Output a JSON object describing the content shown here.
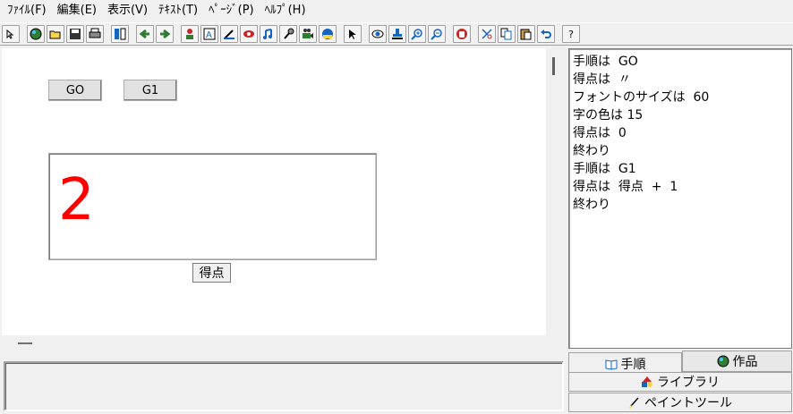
{
  "menu": [
    "ﾌｧｲﾙ(F)",
    "編集(E)",
    "表示(V)",
    "ﾃｷｽﾄ(T)",
    "ﾍﾟｰｼﾞ(P)",
    "ﾍﾙﾌﾟ(H)"
  ],
  "toolbar": {
    "help_label": "?"
  },
  "canvas": {
    "button_go": "GO",
    "button_g1": "G1",
    "score_value": "2",
    "score_label": "得点"
  },
  "editor": {
    "lines": [
      "手順は  GO",
      "得点は  〃",
      "フォントのサイズは  60",
      "字の色は 15",
      "得点は  0",
      "終わり",
      "手順は  G1",
      "得点は  得点  +  1",
      "終わり"
    ]
  },
  "tabs": {
    "steps": "手順",
    "works": "作品",
    "library": "ライブラリ",
    "paint_tool": "ペイントツール"
  },
  "colors": {
    "score_text": "#ff0000"
  }
}
